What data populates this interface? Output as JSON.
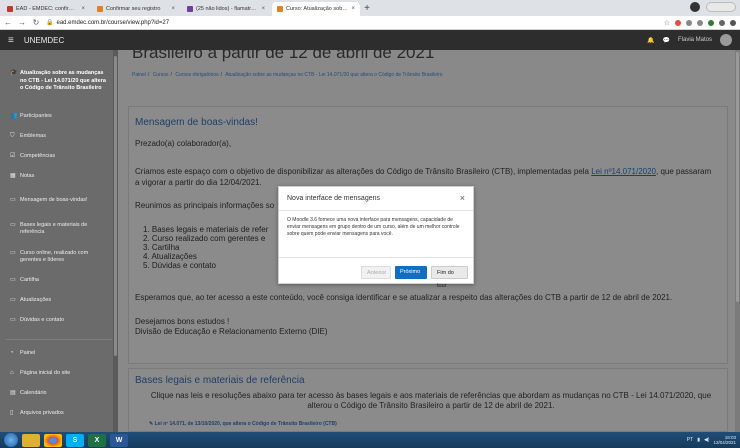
{
  "browser": {
    "tabs": [
      {
        "label": "EAD - EMDEC: confirmação de c",
        "color": "#c0392b",
        "active": false
      },
      {
        "label": "Confirmar seu registro",
        "color": "#e67e22",
        "active": false
      },
      {
        "label": "(25 não lidos) - flamatro@yahoo",
        "color": "#6b3fa0",
        "active": false
      },
      {
        "label": "Curso: Atualização sobre as mud",
        "color": "#e67e22",
        "active": true
      }
    ],
    "close_glyph": "×",
    "new_tab_glyph": "+",
    "url": "ead.emdec.com.br/course/view.php?id=27"
  },
  "navbar": {
    "brand": "UNEMDEC",
    "user_name": "Flavia Matos"
  },
  "drawer": {
    "course_title": "Atualização sobre as mudanças no CTB - Lei 14.071/20 que altera o Código de Trânsito Brasileiro",
    "items": [
      {
        "label": "Participantes",
        "icon": "users-icon"
      },
      {
        "label": "Emblemas",
        "icon": "shield-icon"
      },
      {
        "label": "Competências",
        "icon": "check-square-icon"
      },
      {
        "label": "Notas",
        "icon": "table-icon"
      }
    ],
    "sections": [
      {
        "label": "Mensagem de boas-vindas!"
      },
      {
        "label": "Bases legais e materiais de referência"
      },
      {
        "label": "Curso online, realizado com gerentes e líderes"
      },
      {
        "label": "Cartilha"
      },
      {
        "label": "Atualizações"
      },
      {
        "label": "Dúvidas e contato"
      }
    ],
    "site_items": [
      {
        "label": "Painel",
        "icon": "dashboard-icon"
      },
      {
        "label": "Página inicial do site",
        "icon": "home-icon"
      },
      {
        "label": "Calendário",
        "icon": "calendar-icon"
      },
      {
        "label": "Arquivos privados",
        "icon": "file-icon"
      }
    ]
  },
  "main": {
    "page_title": "Brasileiro a partir de 12 de abril de 2021",
    "breadcrumb": [
      "Painel",
      "Cursos",
      "Cursos obrigatórios",
      "Atualização sobre as mudanças no CTB - Lei 14.071/20 que altera o Código de Trânsito Brasileiro"
    ],
    "breadcrumb_sep": "/",
    "welcome": {
      "heading": "Mensagem de boas-vindas!",
      "greeting": "Prezado(a) colaborador(a),",
      "p1_before": "Criamos este espaço com o objetivo de disponibilizar as alterações do Código de Trânsito Brasileiro (CTB), implementadas pela ",
      "p1_link": "Lei nº14.071/2020",
      "p1_after": ", que passaram",
      "p1_line2": "a vigorar a partir do dia 12/04/2021.",
      "p2": "Reunimos as principais informações so",
      "list": [
        "1. Bases legais e materiais de refer",
        "2. Curso realizado com gerentes e",
        "3. Cartilha",
        "4. Atualizações",
        "5. Dúvidas e contato"
      ],
      "p3": "Esperamos que, ao ter acesso a este conteúdo, você consiga identificar e se atualizar a respeito das alterações do CTB a partir de 12 de abril de 2021.",
      "p4": "Desejamos bons estudos !",
      "p5": "Divisão de Educação e Relacionamento Externo (DIE)"
    },
    "bases": {
      "heading": "Bases legais e materiais de referência",
      "text_line1": "Clique nas leis e resoluções abaixo para ter acesso às bases legais e aos materiais de referências que abordam as mudanças no CTB - Lei 14.071/2020, que",
      "text_line2": "alterou o Código de Trânsito Brasileiro a partir de 12 de abril de 2021.",
      "link": "Lei nº 14.071, de 13/10/2020, que altera o Código de Trânsito Brasileiro (CTB)"
    }
  },
  "modal": {
    "title": "Nova interface de mensagens",
    "close": "×",
    "body": "O Moodle 3.6 fornece uma nova interface para mensagens, capacidade de enviar mensagens em grupo dentro de um curso, além de um melhor controle sobre quem pode enviar mensagens para você.",
    "btn_prev": "Anterior",
    "btn_next": "Próximo",
    "btn_end": "Fim do tour"
  },
  "taskbar": {
    "lang": "PT",
    "time": "18:03",
    "date": "13/04/2021"
  },
  "colors": {
    "modal_primary": "#0f6fc5",
    "navbar_bg": "#2d2d2d",
    "link": "#1f3f6b"
  }
}
